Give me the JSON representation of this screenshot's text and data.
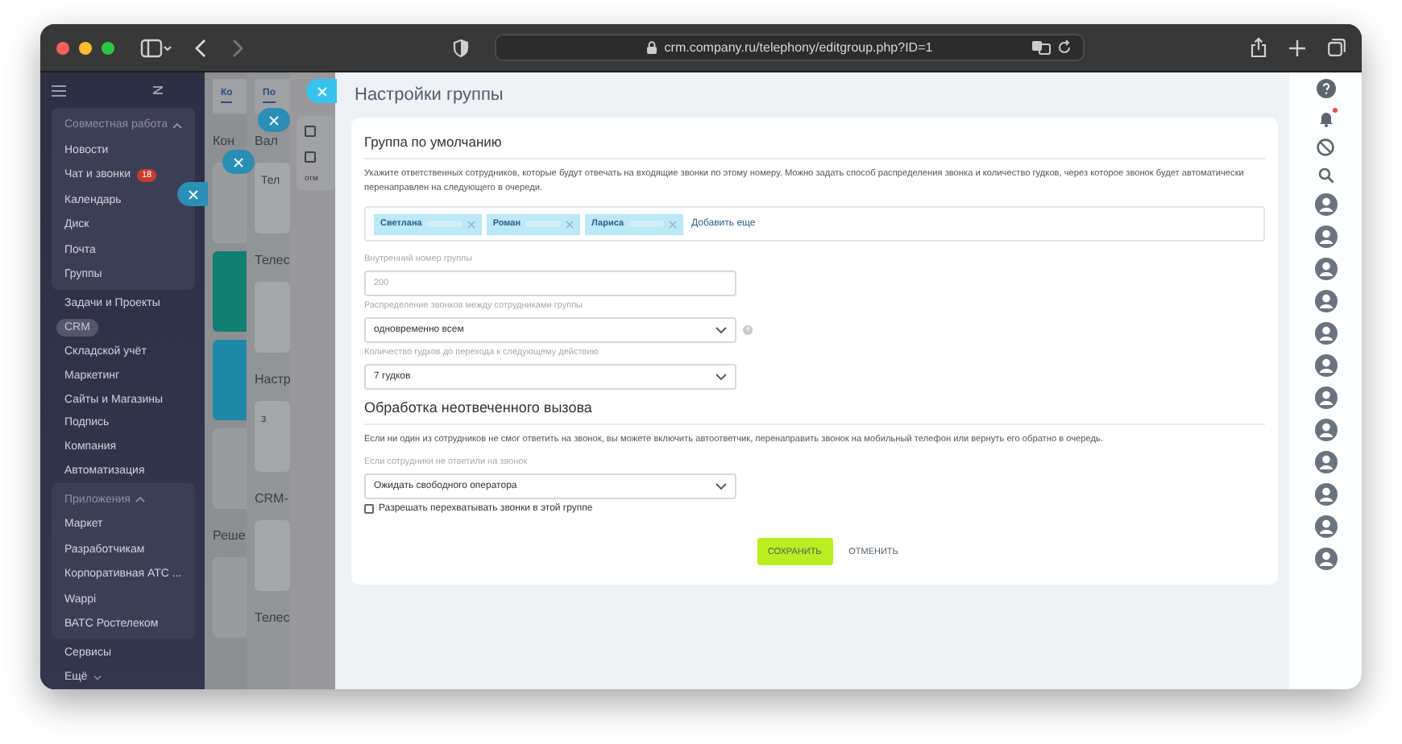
{
  "browser": {
    "url": "crm.company.ru/telephony/editgroup.php?ID=1"
  },
  "sidebar": {
    "entries": [
      {
        "kind": "group",
        "title": "Совместная работа",
        "expanded": true,
        "items": [
          {
            "label": "Новости"
          },
          {
            "label": "Чат и звонки",
            "badge": "18"
          },
          {
            "label": "Календарь"
          },
          {
            "label": "Диск"
          },
          {
            "label": "Почта"
          },
          {
            "label": "Группы"
          }
        ]
      },
      {
        "kind": "link",
        "label": "Задачи и Проекты"
      },
      {
        "kind": "pill",
        "label": "CRM"
      },
      {
        "kind": "link",
        "label": "Складской учёт"
      },
      {
        "kind": "link",
        "label": "Маркетинг"
      },
      {
        "kind": "link",
        "label": "Сайты и Магазины"
      },
      {
        "kind": "link",
        "label": "Подпись"
      },
      {
        "kind": "link",
        "label": "Компания"
      },
      {
        "kind": "link",
        "label": "Автоматизация"
      },
      {
        "kind": "group",
        "title": "Приложения",
        "expanded": true,
        "items": [
          {
            "label": "Маркет"
          },
          {
            "label": "Разработчикам"
          },
          {
            "label": "Корпоративная АТС ..."
          },
          {
            "label": "Wappi"
          },
          {
            "label": "ВАТС Ростелеком"
          }
        ]
      },
      {
        "kind": "link",
        "label": "Сервисы"
      },
      {
        "kind": "more",
        "label": "Ещё",
        "expanded": false
      }
    ]
  },
  "layers": [
    {
      "blocks": [
        {
          "kind": "tab",
          "label": "Ко"
        },
        {
          "kind": "heading",
          "label": "Кон"
        },
        {
          "kind": "card"
        },
        {
          "kind": "card",
          "color": "#127f70"
        },
        {
          "kind": "card",
          "color": "#1f88a8"
        },
        {
          "kind": "card"
        },
        {
          "kind": "heading",
          "label": "Реше"
        },
        {
          "kind": "card"
        }
      ]
    },
    {
      "blocks": [
        {
          "kind": "tab",
          "label": "По"
        },
        {
          "kind": "heading",
          "label": "Вал"
        },
        {
          "kind": "card",
          "label": "Тел"
        },
        {
          "kind": "heading",
          "label": "Телес"
        },
        {
          "kind": "card"
        },
        {
          "kind": "heading",
          "label": "Настр"
        },
        {
          "kind": "card",
          "label": "з"
        },
        {
          "kind": "heading",
          "label": "CRM-"
        },
        {
          "kind": "card"
        },
        {
          "kind": "heading",
          "label": "Телес"
        }
      ]
    },
    {
      "blocks": [
        {
          "kind": "checklist",
          "items": [
            {
              "checked": false
            },
            {
              "checked": false
            }
          ],
          "footer": "отм"
        }
      ]
    }
  ],
  "main": {
    "title": "Настройки группы",
    "section": {
      "heading": "Группа по умолчанию",
      "description": "Укажите ответственных сотрудников, которые будут отвечать на входящие звонки по этому номеру. Можно задать способ распределения звонка и количество гудков, через которое звонок будет автоматически перенаправлен на следующего в очереди.",
      "members": [
        {
          "name": "Светлана"
        },
        {
          "name": "Роман"
        },
        {
          "name": "Лариса"
        }
      ],
      "add_link": "Добавить еще",
      "fields": [
        {
          "kind": "input",
          "label": "Внутренний номер группы",
          "placeholder": "200"
        },
        {
          "kind": "select",
          "label": "Распределение звонков между сотрудниками группы",
          "value": "одновременно всем",
          "help": true
        },
        {
          "kind": "select",
          "label": "Количество гудков до перехода к следующему действию",
          "value": "7 гудков"
        }
      ]
    },
    "unanswered": {
      "heading": "Обработка неотвеченного вызова",
      "description": "Если ни один из сотрудников не смог ответить на звонок, вы можете включить автоответчик, перенаправить звонок на мобильный телефон или вернуть его обратно в очередь.",
      "fields": [
        {
          "kind": "select",
          "label": "Если сотрудники не ответили на звонок",
          "value": "Ожидать свободного оператора"
        }
      ],
      "checkbox": {
        "label": "Разрешать перехватывать звонки в этой группе",
        "checked": false
      }
    },
    "buttons": [
      {
        "kind": "primary",
        "label": "СОХРАНИТЬ"
      },
      {
        "kind": "link",
        "label": "ОТМЕНИТЬ"
      }
    ]
  },
  "right_bar": {
    "notifications": true
  }
}
